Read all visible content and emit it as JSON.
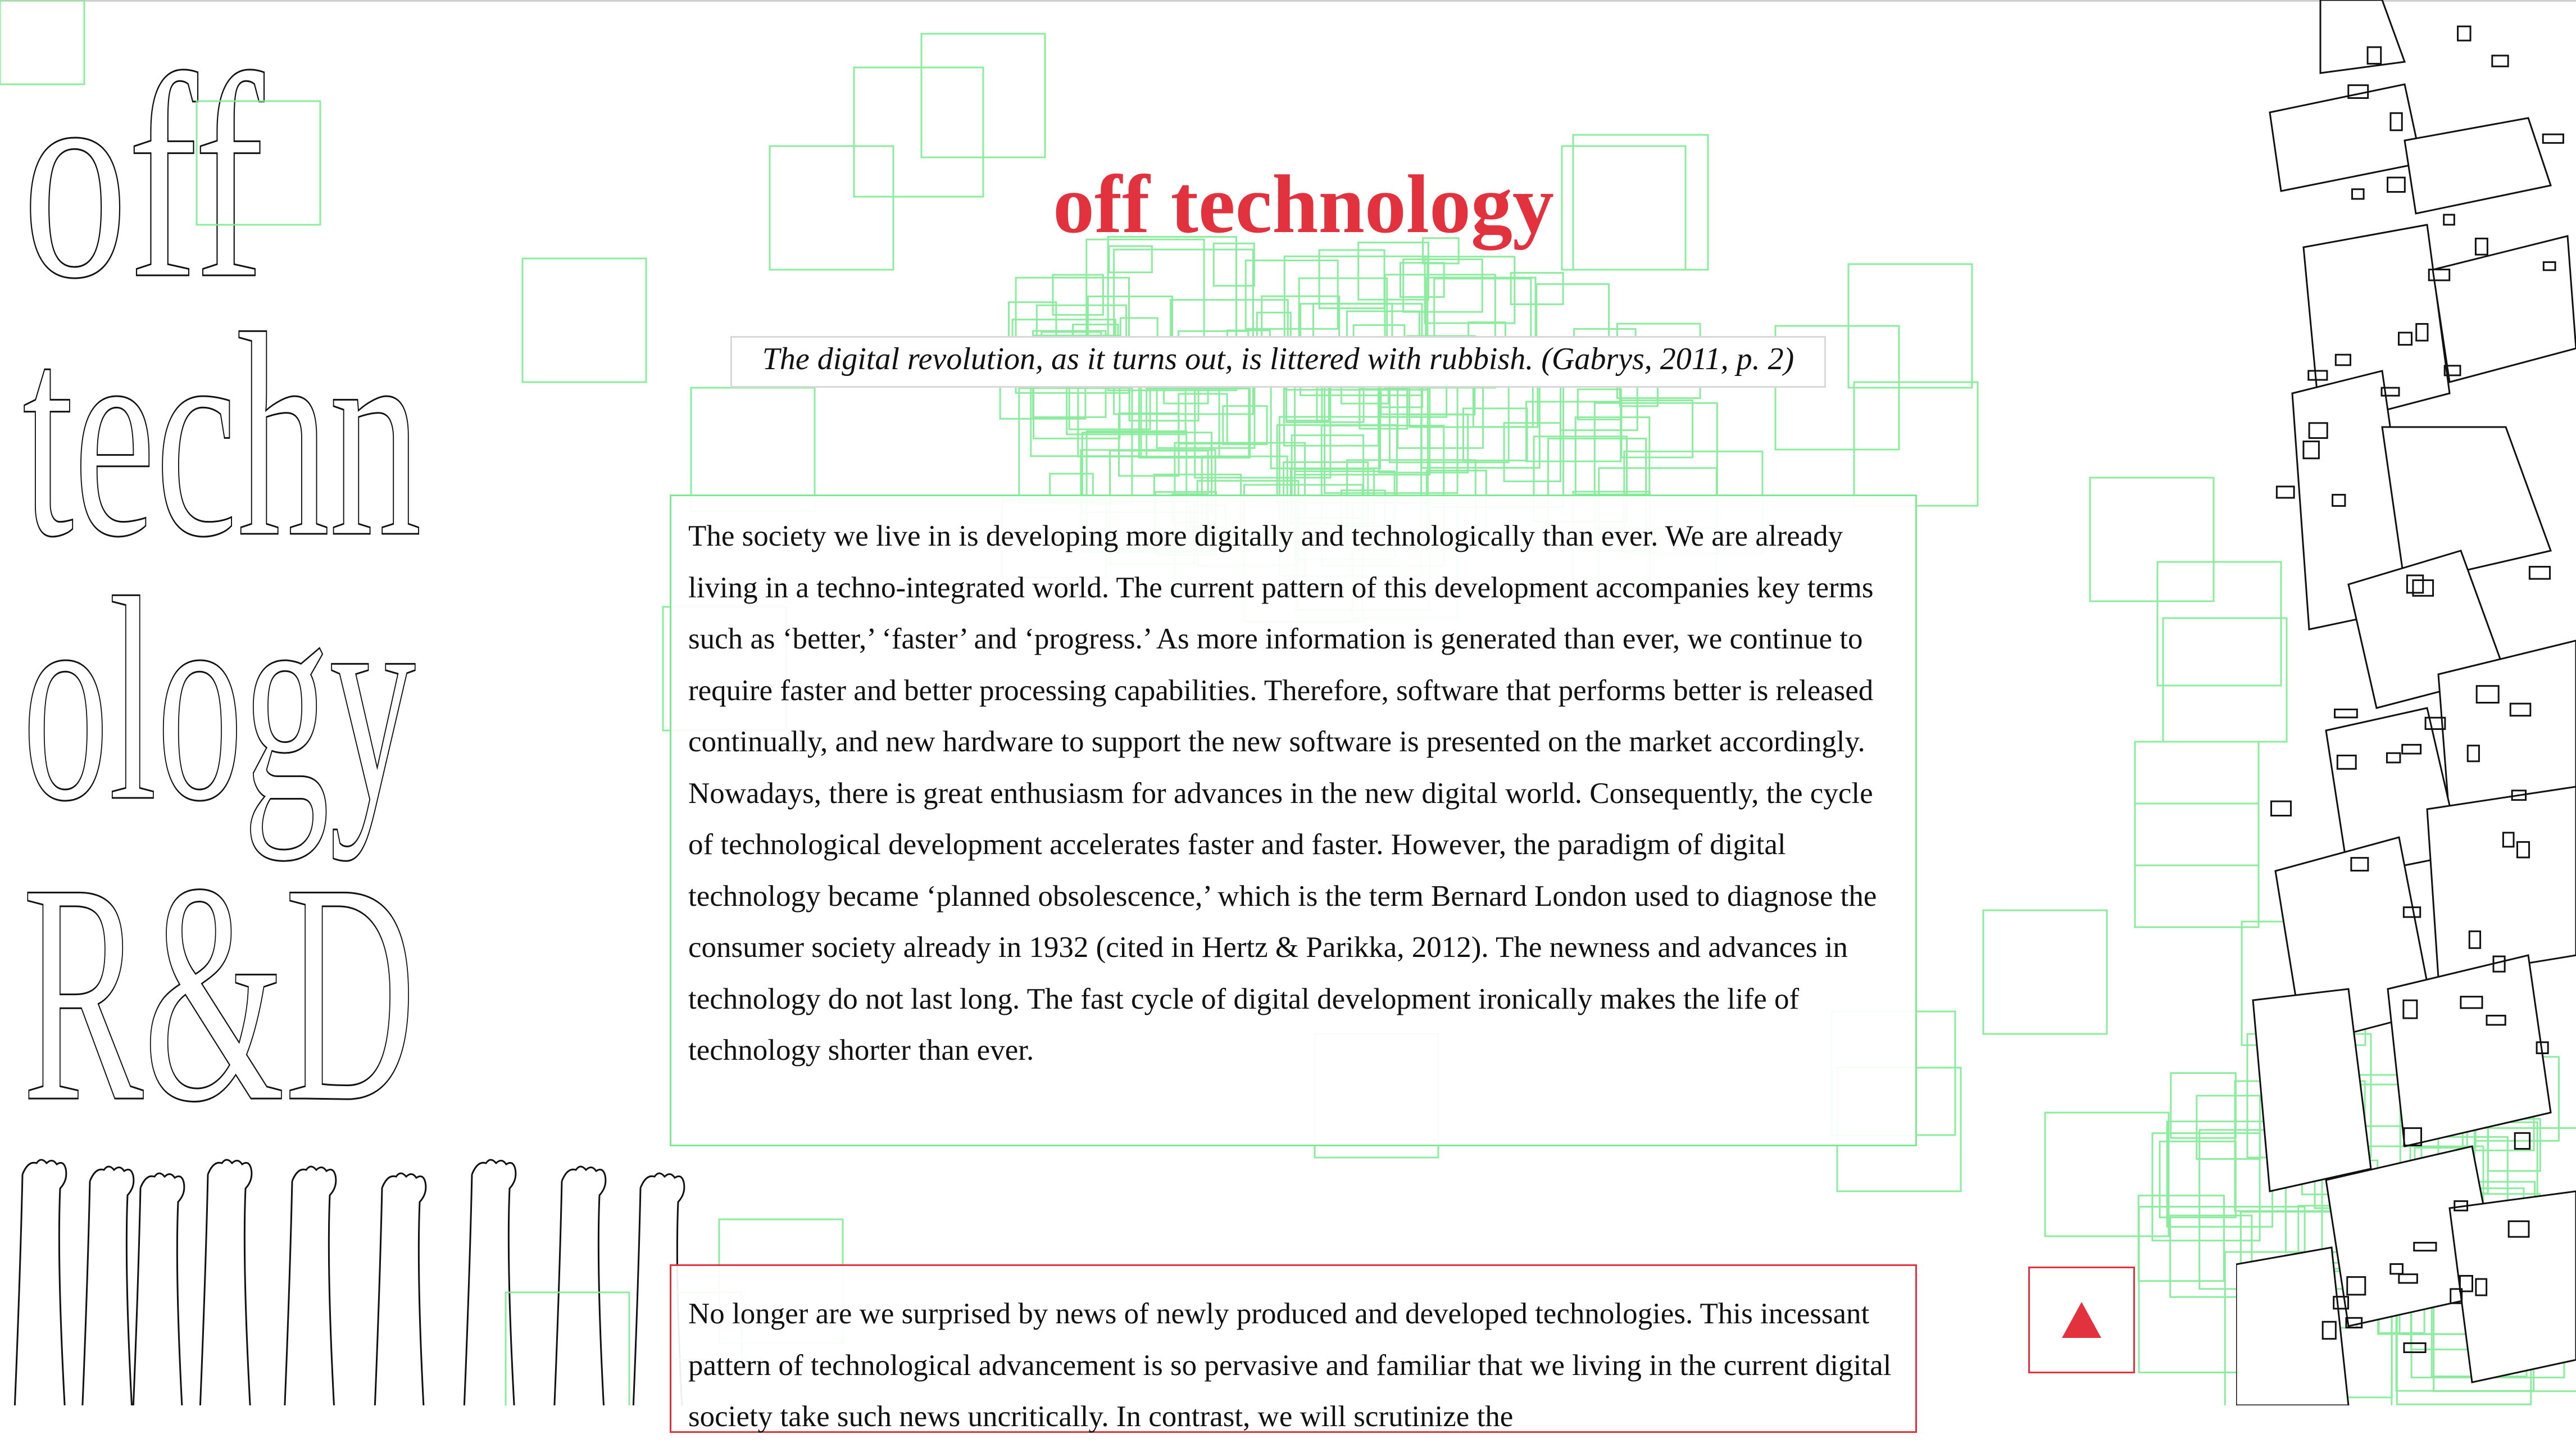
{
  "sidebar": {
    "title_lines": [
      "off",
      "techn",
      "ology",
      "R&D"
    ]
  },
  "main": {
    "title": "off technology",
    "quote": "The digital revolution, as it turns out, is littered with rubbish. (Gabrys, 2011, p. 2)",
    "paragraphs": [
      "The society we live in is developing more digitally and technologically than ever. We are already living in a techno-integrated world. The current pattern of this development accompanies key terms such as ‘better,’ ‘faster’ and ‘progress.’ As more information is generated than ever, we continue to require faster and better processing capabilities. Therefore, software that performs better is released continually, and new hardware to support the new software is presented on the market accordingly. Nowadays, there is great enthusiasm for advances in the new digital world. Consequently, the cycle of technological development accelerates faster and faster. However, the paradigm of digital technology became ‘planned obsolescence,’ which is the term Bernard London used to diagnose the consumer society already in 1932 (cited in Hertz & Parikka, 2012). The newness and advances in technology do not last long. The fast cycle of digital development ironically makes the life of technology shorter than ever.",
      "No longer are we surprised by news of newly produced and developed technologies. This incessant pattern of technological advancement is so pervasive and familiar that we living in the current digital society take such news uncritically. In contrast, we will scrutinize the"
    ]
  },
  "scroll_top_button": {
    "icon": "triangle-up-icon"
  },
  "colors": {
    "accent_red": "#e2323e",
    "green_squares": "#7fea94",
    "ink": "#111111",
    "background": "#ffffff"
  }
}
